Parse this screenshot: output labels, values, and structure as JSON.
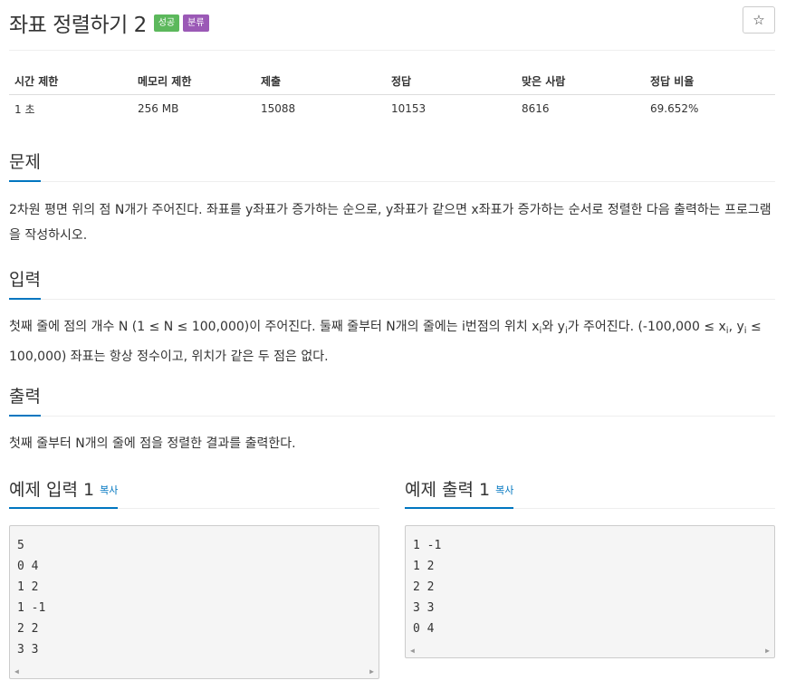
{
  "header": {
    "title": "좌표 정렬하기 2",
    "badges": [
      "성공",
      "분류"
    ],
    "star": "☆"
  },
  "info": {
    "headers": [
      "시간 제한",
      "메모리 제한",
      "제출",
      "정답",
      "맞은 사람",
      "정답 비율"
    ],
    "values": [
      "1 초",
      "256 MB",
      "15088",
      "10153",
      "8616",
      "69.652%"
    ]
  },
  "problem": {
    "heading": "문제",
    "text": "2차원 평면 위의 점 N개가 주어진다. 좌표를 y좌표가 증가하는 순으로, y좌표가 같으면 x좌표가 증가하는 순서로 정렬한 다음 출력하는 프로그램을 작성하시오."
  },
  "input": {
    "heading": "입력",
    "part1": "첫째 줄에 점의 개수 N (1 ≤ N ≤ 100,000)이 주어진다. 둘째 줄부터 N개의 줄에는 i번점의 위치 x",
    "sub_i": "i",
    "part2": "와 y",
    "part3": "가 주어진다. (-100,000 ≤ x",
    "part4": ", y",
    "part5": " ≤ 100,000) 좌표는 항상 정수이고, 위치가 같은 두 점은 없다."
  },
  "output": {
    "heading": "출력",
    "text": "첫째 줄부터 N개의 줄에 점을 정렬한 결과를 출력한다."
  },
  "sample_input": {
    "heading": "예제 입력 1",
    "copy": "복사",
    "lines": [
      "5",
      "0 4",
      "1 2",
      "1 -1",
      "2 2",
      "3 3"
    ]
  },
  "sample_output": {
    "heading": "예제 출력 1",
    "copy": "복사",
    "lines": [
      "1 -1",
      "1 2",
      "2 2",
      "3 3",
      "0 4"
    ]
  },
  "scroll": {
    "left": "◀",
    "right": "▶"
  }
}
